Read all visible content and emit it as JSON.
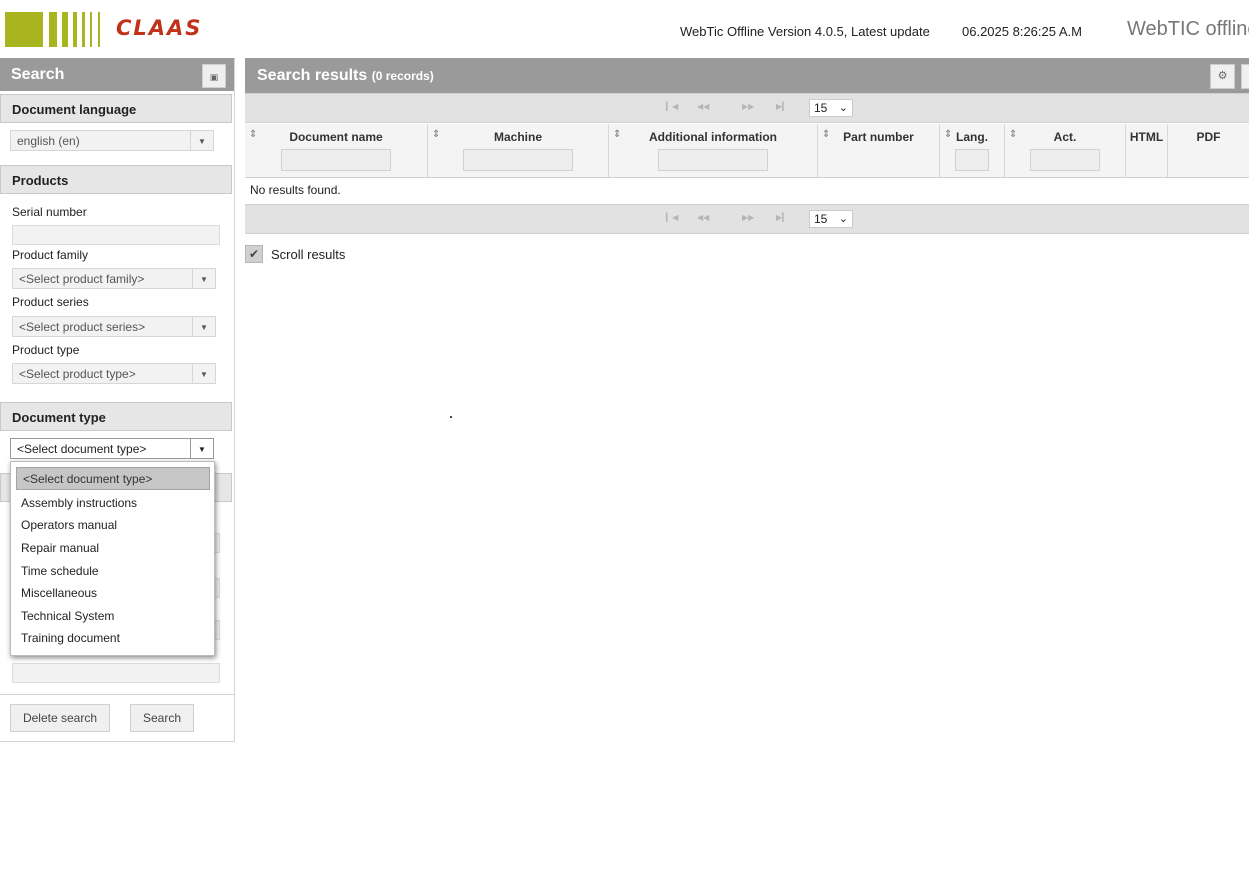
{
  "header": {
    "logo_text": "CLAAS",
    "version_text": "WebTic Offline Version 4.0.5, Latest update",
    "datetime": "06.2025 8:26:25 A.M",
    "brand": "WebTIC offline"
  },
  "left_panel": {
    "title": "Search",
    "collapse_icon": "collapse-icon",
    "document_language": {
      "header": "Document language",
      "value": "english (en)"
    },
    "products": {
      "header": "Products",
      "serial_label": "Serial number",
      "serial_value": "",
      "family_label": "Product family",
      "family_value": "<Select product family>",
      "series_label": "Product series",
      "series_value": "<Select product series>",
      "type_label": "Product type",
      "type_value": "<Select product type>"
    },
    "document_type": {
      "header": "Document type",
      "value": "<Select document type>",
      "options": [
        "<Select document type>",
        "Assembly instructions",
        "Operators manual",
        "Repair manual",
        "Time schedule",
        "Miscellaneous",
        "Technical System",
        "Training document"
      ]
    },
    "delete_label": "Delete search",
    "search_label": "Search"
  },
  "results": {
    "title": "Search results",
    "count": "(0 records)",
    "page_size": "15",
    "columns": [
      "Document name",
      "Machine",
      "Additional information",
      "Part number",
      "Lang.",
      "Act.",
      "HTML",
      "PDF"
    ],
    "empty_text": "No results found.",
    "scroll_label": "Scroll results",
    "scroll_checked": true
  },
  "colors": {
    "brand_green": "#a8b51e",
    "brand_red": "#c0331a",
    "panel_header_gray": "#9a9a9a"
  }
}
